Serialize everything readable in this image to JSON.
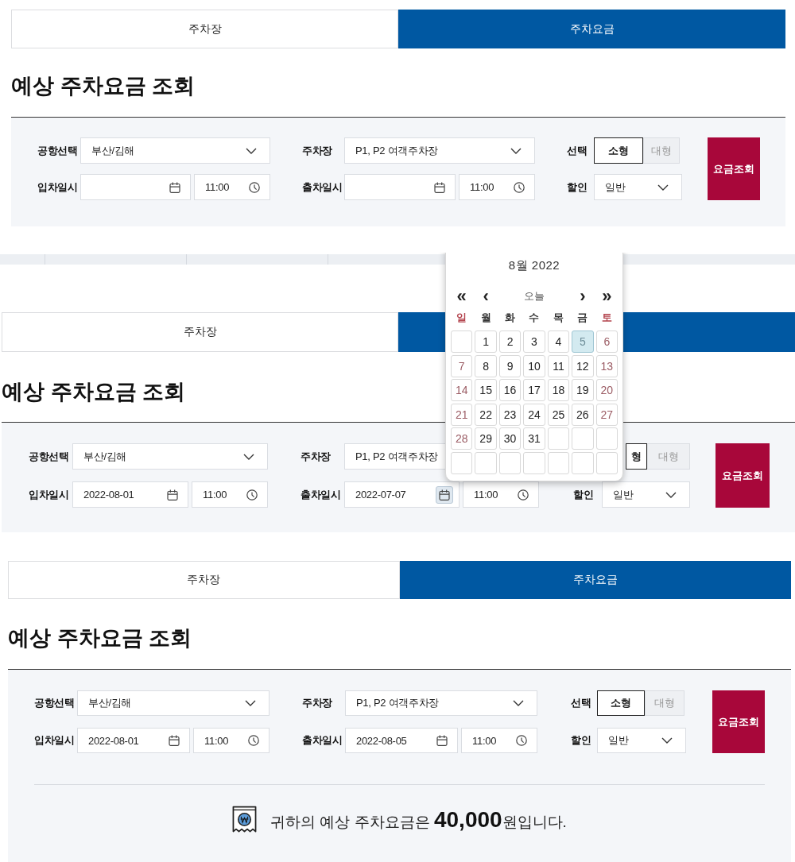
{
  "screens": [
    {
      "tabs": [
        {
          "label": "주차장",
          "selected": false
        },
        {
          "label": "주차요금",
          "selected": true
        }
      ],
      "title": "예상 주차요금 조회",
      "form": {
        "fields": [
          {
            "kind": "select",
            "label": "공항선택",
            "value": "부산/김해"
          },
          {
            "kind": "select",
            "label": "주차장",
            "value": "P1, P2 여객주차장"
          },
          {
            "kind": "toggle",
            "label": "선택",
            "options": [
              {
                "label": "소형",
                "selected": true
              },
              {
                "label": "대형",
                "selected": false
              }
            ]
          },
          {
            "kind": "datetime",
            "label": "입차일시",
            "time": "11:00"
          },
          {
            "kind": "datetime",
            "label": "출차일시",
            "time": "11:00"
          },
          {
            "kind": "select",
            "label": "할인",
            "value": "일반"
          }
        ],
        "submit": "요금조회"
      }
    },
    {
      "table_edge": true,
      "tabs": [
        {
          "label": "주차장",
          "selected": false
        },
        {
          "selected": true
        }
      ],
      "title": "예상 주차요금 조회",
      "form": {
        "fields": [
          {
            "kind": "select",
            "label": "공항선택",
            "value": "부산/김해"
          },
          {
            "kind": "select",
            "label": "주차장",
            "value": "P1, P2 여객주차장"
          },
          {
            "kind": "toggle",
            "options": [
              {
                "label": "형",
                "selected": true
              },
              {
                "label": "대형",
                "selected": false
              }
            ]
          },
          {
            "kind": "datetime",
            "label": "입차일시",
            "date": "2022-08-01",
            "time": "11:00"
          },
          {
            "kind": "datetime",
            "label": "출차일시",
            "date": "2022-07-07",
            "time": "11:00",
            "picker_open": true
          },
          {
            "kind": "select",
            "label": "할인",
            "value": "일반"
          }
        ],
        "submit": "요금조회"
      },
      "calendar": {
        "title": "8월 2022",
        "nav": [
          "«",
          "‹",
          "오늘",
          "›",
          "»"
        ],
        "weekdays": [
          {
            "label": "일",
            "weekend": true
          },
          {
            "label": "월",
            "weekend": false
          },
          {
            "label": "화",
            "weekend": false
          },
          {
            "label": "수",
            "weekend": false
          },
          {
            "label": "목",
            "weekend": false
          },
          {
            "label": "금",
            "weekend": false
          },
          {
            "label": "토",
            "weekend": true
          }
        ],
        "weeks": [
          [
            {
              "kind": "blank"
            },
            {
              "kind": "day",
              "label": "1",
              "selected": false
            },
            {
              "kind": "day",
              "label": "2",
              "selected": false
            },
            {
              "kind": "day",
              "label": "3",
              "selected": false
            },
            {
              "kind": "day",
              "label": "4",
              "selected": false
            },
            {
              "kind": "day",
              "label": "5",
              "selected": true
            },
            {
              "kind": "day",
              "label": "6",
              "selected": false
            }
          ],
          [
            {
              "kind": "day",
              "label": "7",
              "selected": false
            },
            {
              "kind": "day",
              "label": "8",
              "selected": false
            },
            {
              "kind": "day",
              "label": "9",
              "selected": false
            },
            {
              "kind": "day",
              "label": "10",
              "selected": false
            },
            {
              "kind": "day",
              "label": "11",
              "selected": false
            },
            {
              "kind": "day",
              "label": "12",
              "selected": false
            },
            {
              "kind": "day",
              "label": "13",
              "selected": false
            }
          ],
          [
            {
              "kind": "day",
              "label": "14",
              "selected": false
            },
            {
              "kind": "day",
              "label": "15",
              "selected": false
            },
            {
              "kind": "day",
              "label": "16",
              "selected": false
            },
            {
              "kind": "day",
              "label": "17",
              "selected": false
            },
            {
              "kind": "day",
              "label": "18",
              "selected": false
            },
            {
              "kind": "day",
              "label": "19",
              "selected": false
            },
            {
              "kind": "day",
              "label": "20",
              "selected": false
            }
          ],
          [
            {
              "kind": "day",
              "label": "21",
              "selected": false
            },
            {
              "kind": "day",
              "label": "22",
              "selected": false
            },
            {
              "kind": "day",
              "label": "23",
              "selected": false
            },
            {
              "kind": "day",
              "label": "24",
              "selected": false
            },
            {
              "kind": "day",
              "label": "25",
              "selected": false
            },
            {
              "kind": "day",
              "label": "26",
              "selected": false
            },
            {
              "kind": "day",
              "label": "27",
              "selected": false
            }
          ],
          [
            {
              "kind": "day",
              "label": "28",
              "selected": false
            },
            {
              "kind": "day",
              "label": "29",
              "selected": false
            },
            {
              "kind": "day",
              "label": "30",
              "selected": false
            },
            {
              "kind": "day",
              "label": "31",
              "selected": false
            },
            {
              "kind": "blank"
            },
            {
              "kind": "blank"
            },
            {
              "kind": "blank"
            }
          ],
          [
            {
              "kind": "blank"
            },
            {
              "kind": "blank"
            },
            {
              "kind": "blank"
            },
            {
              "kind": "blank"
            },
            {
              "kind": "blank"
            },
            {
              "kind": "blank"
            },
            {
              "kind": "blank"
            }
          ]
        ]
      }
    },
    {
      "tabs": [
        {
          "label": "주차장",
          "selected": false
        },
        {
          "label": "주차요금",
          "selected": true
        }
      ],
      "title": "예상 주차요금 조회",
      "form": {
        "fields": [
          {
            "kind": "select",
            "label": "공항선택",
            "value": "부산/김해"
          },
          {
            "kind": "select",
            "label": "주차장",
            "value": "P1, P2 여객주차장"
          },
          {
            "kind": "toggle",
            "label": "선택",
            "options": [
              {
                "label": "소형",
                "selected": true
              },
              {
                "label": "대형",
                "selected": false
              }
            ]
          },
          {
            "kind": "datetime",
            "label": "입차일시",
            "date": "2022-08-01",
            "time": "11:00"
          },
          {
            "kind": "datetime",
            "label": "출차일시",
            "date": "2022-08-05",
            "time": "11:00"
          },
          {
            "kind": "select",
            "label": "할인",
            "value": "일반"
          }
        ],
        "submit": "요금조회",
        "result": "귀하의 예상 주차요금은 **40,000**원입니다."
      }
    }
  ]
}
